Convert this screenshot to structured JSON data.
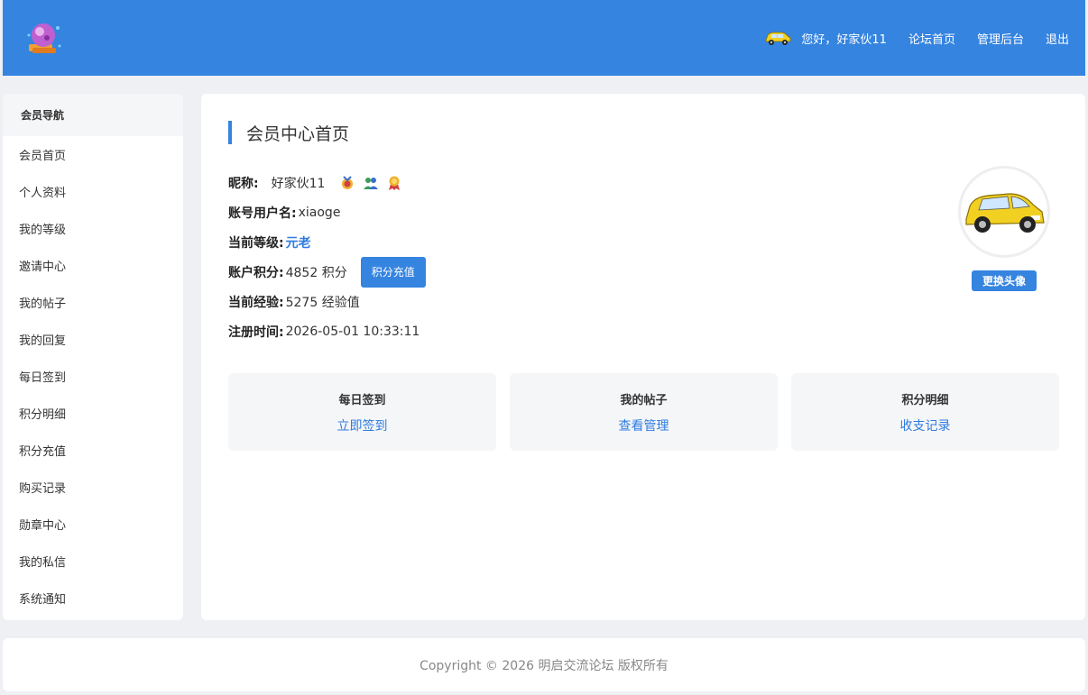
{
  "header": {
    "logo": "crystal-ball-logo",
    "greeting": "您好，好家伙11",
    "links": [
      "论坛首页",
      "管理后台",
      "退出"
    ],
    "accent_color": "#3584e0"
  },
  "sidebar": {
    "title": "会员导航",
    "items": [
      "会员首页",
      "个人资料",
      "我的等级",
      "邀请中心",
      "我的帖子",
      "我的回复",
      "每日签到",
      "积分明细",
      "积分充值",
      "购买记录",
      "勋章中心",
      "我的私信",
      "系统通知"
    ]
  },
  "main": {
    "title": "会员中心首页",
    "nickname_label": "昵称:",
    "nickname": "好家伙11",
    "badges": [
      "medal-badge-icon",
      "users-badge-icon",
      "ribbon-badge-icon"
    ],
    "username_label": "账号用户名:",
    "username": "xiaoge",
    "level_label": "当前等级:",
    "level": "元老",
    "points_label": "账户积分:",
    "points": "4852 积分",
    "recharge_button": "积分充值",
    "exp_label": "当前经验:",
    "exp": "5275 经验值",
    "register_label": "注册时间:",
    "register_time": "2026-05-01 10:33:11",
    "change_avatar_button": "更换头像",
    "avatar": "yellow-car-avatar",
    "cards": [
      {
        "title": "每日签到",
        "link": "立即签到"
      },
      {
        "title": "我的帖子",
        "link": "查看管理"
      },
      {
        "title": "积分明细",
        "link": "收支记录"
      }
    ]
  },
  "footer": {
    "copyright": "Copyright © 2026 明启交流论坛 版权所有"
  }
}
